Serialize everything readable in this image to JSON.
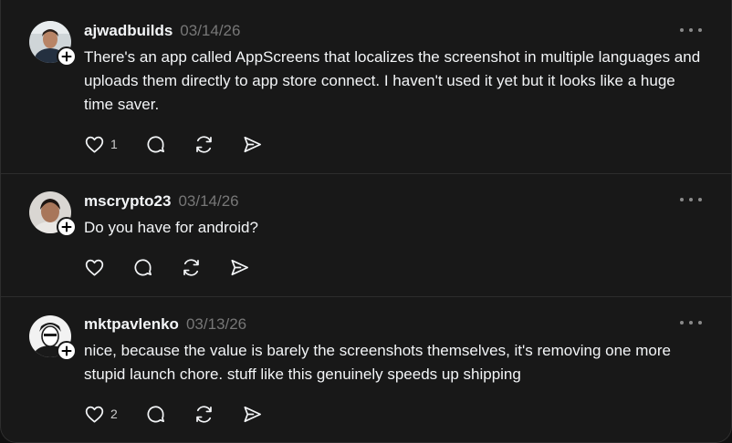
{
  "replies": [
    {
      "username": "ajwadbuilds",
      "date": "03/14/26",
      "text": "There's an app called AppScreens that localizes the screenshot in multiple languages and uploads them directly to app store connect. I haven't used it yet but it looks like a huge time saver.",
      "likes": "1",
      "icons": [
        "heart-icon",
        "comment-icon",
        "repost-icon",
        "share-icon",
        "more-icon",
        "follow-plus-icon"
      ]
    },
    {
      "username": "mscrypto23",
      "date": "03/14/26",
      "text": "Do you have for android?",
      "likes": "",
      "icons": [
        "heart-icon",
        "comment-icon",
        "repost-icon",
        "share-icon",
        "more-icon",
        "follow-plus-icon"
      ]
    },
    {
      "username": "mktpavlenko",
      "date": "03/13/26",
      "text": "nice, because the value is barely the screenshots themselves, it's removing one more stupid launch chore. stuff like this genuinely speeds up shipping",
      "likes": "2",
      "icons": [
        "heart-icon",
        "comment-icon",
        "repost-icon",
        "share-icon",
        "more-icon",
        "follow-plus-icon"
      ]
    }
  ],
  "colors": {
    "background": "#181818",
    "text": "#f3f5f7",
    "muted": "#777777",
    "divider": "#2d2d2d"
  }
}
